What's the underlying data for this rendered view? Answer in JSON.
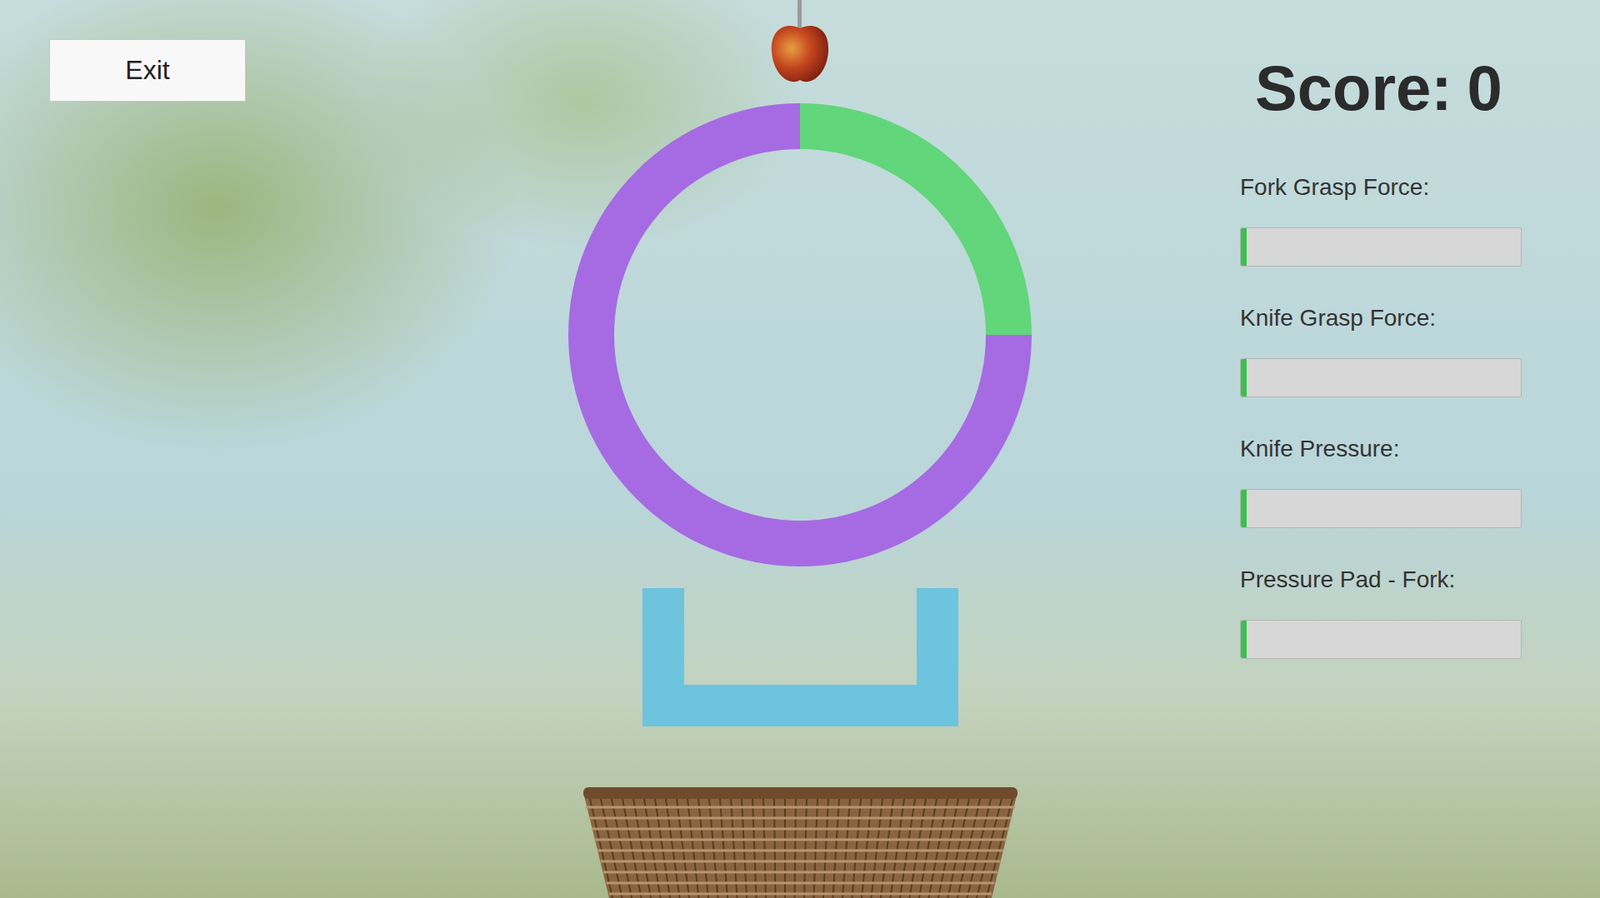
{
  "exit_button": {
    "label": "Exit"
  },
  "score": {
    "label": "Score:",
    "value": "0"
  },
  "ring": {
    "segments": [
      {
        "start": 0,
        "end": 0.25,
        "color": "#62d67a"
      },
      {
        "start": 0.25,
        "end": 1,
        "color": "#a66be3"
      }
    ]
  },
  "meters": [
    {
      "label": "Fork Grasp Force:",
      "level": 0.02
    },
    {
      "label": "Knife Grasp Force:",
      "level": 0.02
    },
    {
      "label": "Knife Pressure:",
      "level": 0.02
    },
    {
      "label": "Pressure Pad - Fork:",
      "level": 0.02
    }
  ]
}
